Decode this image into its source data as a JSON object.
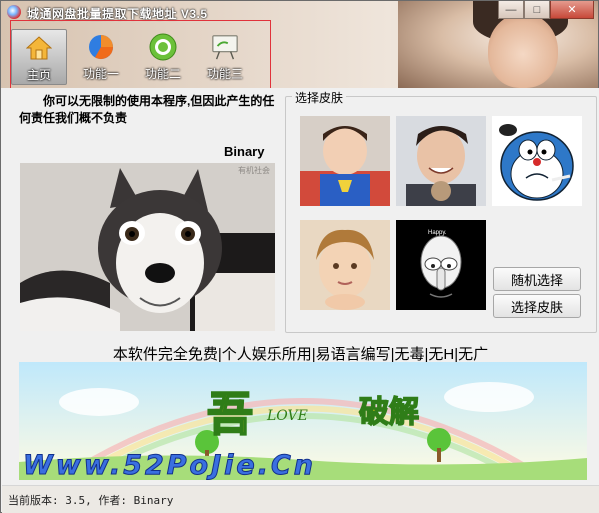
{
  "window": {
    "title": "城通网盘批量提取下载地址 V3.5",
    "controls": {
      "minimize": "—",
      "maximize": "□",
      "close": "✕"
    }
  },
  "toolbar": {
    "items": [
      {
        "label": "主页",
        "icon": "home-icon",
        "active": true
      },
      {
        "label": "功能一",
        "icon": "pie-chart-icon",
        "active": false
      },
      {
        "label": "功能二",
        "icon": "target-icon",
        "active": false
      },
      {
        "label": "功能三",
        "icon": "presentation-board-icon",
        "active": false
      }
    ],
    "highlight_color": "#e0323b"
  },
  "main": {
    "disclaimer": "你可以无限制的使用本程序,但因此产生的任何责任我们概不负责",
    "author_signature": "Binary",
    "image_watermark": "有机社会",
    "skin_panel": {
      "legend": "选择皮肤",
      "thumbnails": [
        {
          "name": "skin-superman-boy"
        },
        {
          "name": "skin-smiling-man"
        },
        {
          "name": "skin-doraemon"
        },
        {
          "name": "skin-curly-kid"
        },
        {
          "name": "skin-squidward"
        }
      ],
      "bubble_text": "Happy.",
      "random_button": "随机选择",
      "select_button": "选择皮肤"
    },
    "slogan": "本软件完全免费|个人娱乐所用|易语言编写|无毒|无H|无广",
    "banner": {
      "char_left": "吾",
      "love_text": "LOVE",
      "char_right": "破解",
      "url": "Www.52PoJie.Cn"
    }
  },
  "statusbar": {
    "text": "当前版本: 3.5, 作者: Binary"
  },
  "colors": {
    "accent_red": "#e0323b",
    "window_bg": "#f0f0f0",
    "banner_sky": "#c6ecfb"
  }
}
